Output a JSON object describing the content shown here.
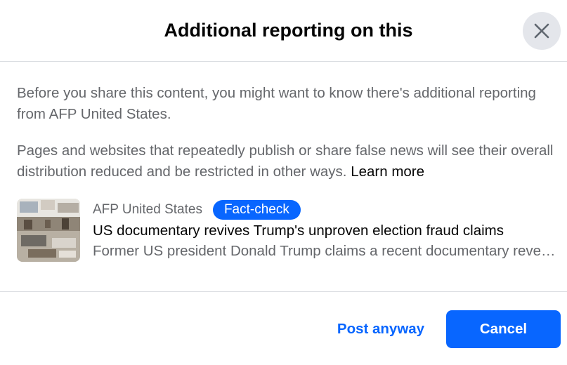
{
  "dialog": {
    "title": "Additional reporting on this",
    "close_icon": "close-icon"
  },
  "body": {
    "paragraph1": "Before you share this content, you might want to know there's additional reporting from AFP United States.",
    "paragraph2": "Pages and websites that repeatedly publish or share false news will see their overall distribution reduced and be restricted in other ways.",
    "learn_more": "Learn more"
  },
  "article": {
    "source": "AFP United States",
    "badge": "Fact-check",
    "headline": "US documentary revives Trump's unproven election fraud claims",
    "snippet": "Former US president Donald Trump claims a recent documentary reveals evidence of election fraud"
  },
  "footer": {
    "post_anyway": "Post anyway",
    "cancel": "Cancel"
  },
  "colors": {
    "accent": "#0866ff",
    "secondary_text": "#65676b",
    "primary_text": "#050505",
    "close_bg": "#e4e6eb",
    "divider": "#dadde1"
  }
}
